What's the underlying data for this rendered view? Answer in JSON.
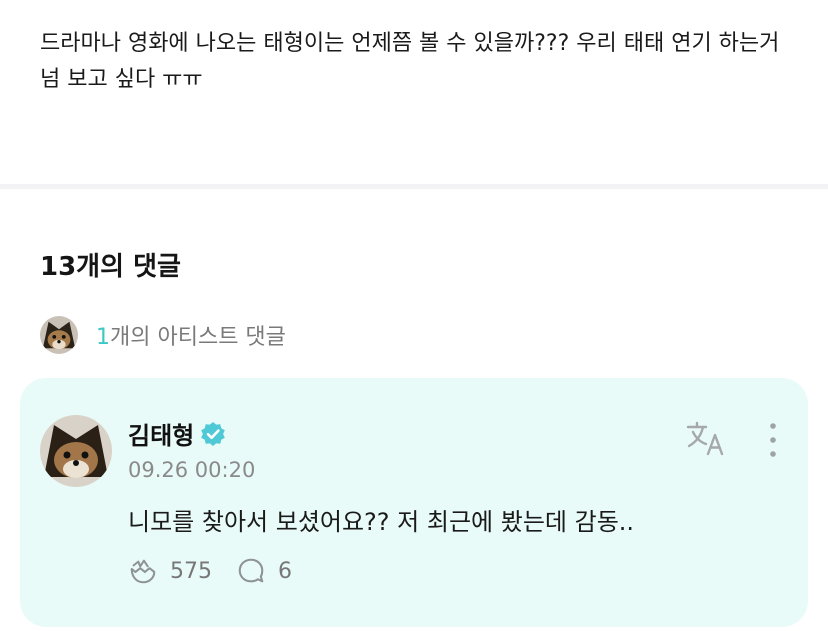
{
  "post": {
    "text": "드라마나 영화에 나오는 태형이는 언제쯤 볼 수 있을까??? 우리 태태 연기 하는거 넘 보고 싶다 ㅠㅠ"
  },
  "comments": {
    "count_label": "13개의 댓글",
    "artist_count": "1",
    "artist_label": "개의 아티스트 댓글"
  },
  "comment": {
    "author": "김태형",
    "timestamp": "09.26 00:20",
    "text": "니모를 찾아서 보셨어요?? 저 최근에 봤는데 감동..",
    "likes": "575",
    "replies": "6"
  },
  "colors": {
    "accent": "#3cc9c3",
    "card_bg": "#e9fbf8",
    "verified": "#4fc9d6"
  },
  "icons": {
    "verified": "verified-badge-icon",
    "translate": "translate-icon",
    "more": "more-vertical-icon",
    "like": "like-icon",
    "reply": "reply-icon"
  }
}
